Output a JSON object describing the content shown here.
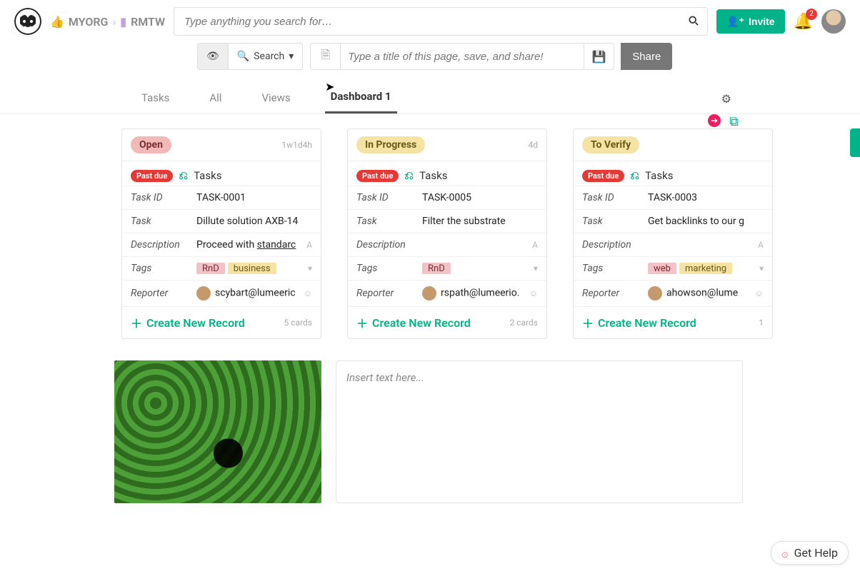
{
  "breadcrumb": {
    "org": "MYORG",
    "project": "RMTW"
  },
  "search": {
    "placeholder": "Type anything you search for…"
  },
  "invite_label": "Invite",
  "notification_count": "2",
  "secondbar": {
    "search_label": "Search",
    "title_placeholder": "Type a title of this page, save, and share!",
    "share_label": "Share"
  },
  "tabs": [
    "Tasks",
    "All",
    "Views",
    "Dashboard 1"
  ],
  "active_tab": "Dashboard 1",
  "columns": [
    {
      "status": "Open",
      "pill_class": "pill-open",
      "age": "1w1d4h",
      "pastdue": "Past due",
      "tasks": "Tasks",
      "rows": {
        "task_id_label": "Task ID",
        "task_id": "TASK-0001",
        "task_label": "Task",
        "task": "Dillute solution AXB-14",
        "desc_label": "Description",
        "desc": "Proceed with standard",
        "tags_label": "Tags",
        "tags": [
          "RnD",
          "business"
        ],
        "tag_classes": [
          "tag-rnd",
          "tag-biz"
        ],
        "rep_label": "Reporter",
        "reporter": "scybart@lumeeric"
      },
      "create": "Create New Record",
      "count": "5 cards"
    },
    {
      "status": "In Progress",
      "pill_class": "pill-progress",
      "age": "4d",
      "pastdue": "Past due",
      "tasks": "Tasks",
      "rows": {
        "task_id_label": "Task ID",
        "task_id": "TASK-0005",
        "task_label": "Task",
        "task": "Filter the substrate",
        "desc_label": "Description",
        "desc": "",
        "tags_label": "Tags",
        "tags": [
          "RnD"
        ],
        "tag_classes": [
          "tag-rnd"
        ],
        "rep_label": "Reporter",
        "reporter": "rspath@lumeerio."
      },
      "create": "Create New Record",
      "count": "2 cards"
    },
    {
      "status": "To Verify",
      "pill_class": "pill-verify",
      "age": "",
      "pastdue": "Past due",
      "tasks": "Tasks",
      "rows": {
        "task_id_label": "Task ID",
        "task_id": "TASK-0003",
        "task_label": "Task",
        "task": "Get backlinks to our g",
        "desc_label": "Description",
        "desc": "",
        "tags_label": "Tags",
        "tags": [
          "web",
          "marketing"
        ],
        "tag_classes": [
          "tag-web",
          "tag-mkt"
        ],
        "rep_label": "Reporter",
        "reporter": "ahowson@lume"
      },
      "create": "Create New Record",
      "count": "1"
    }
  ],
  "textbox_placeholder": "Insert text here...",
  "help_label": "Get Help"
}
